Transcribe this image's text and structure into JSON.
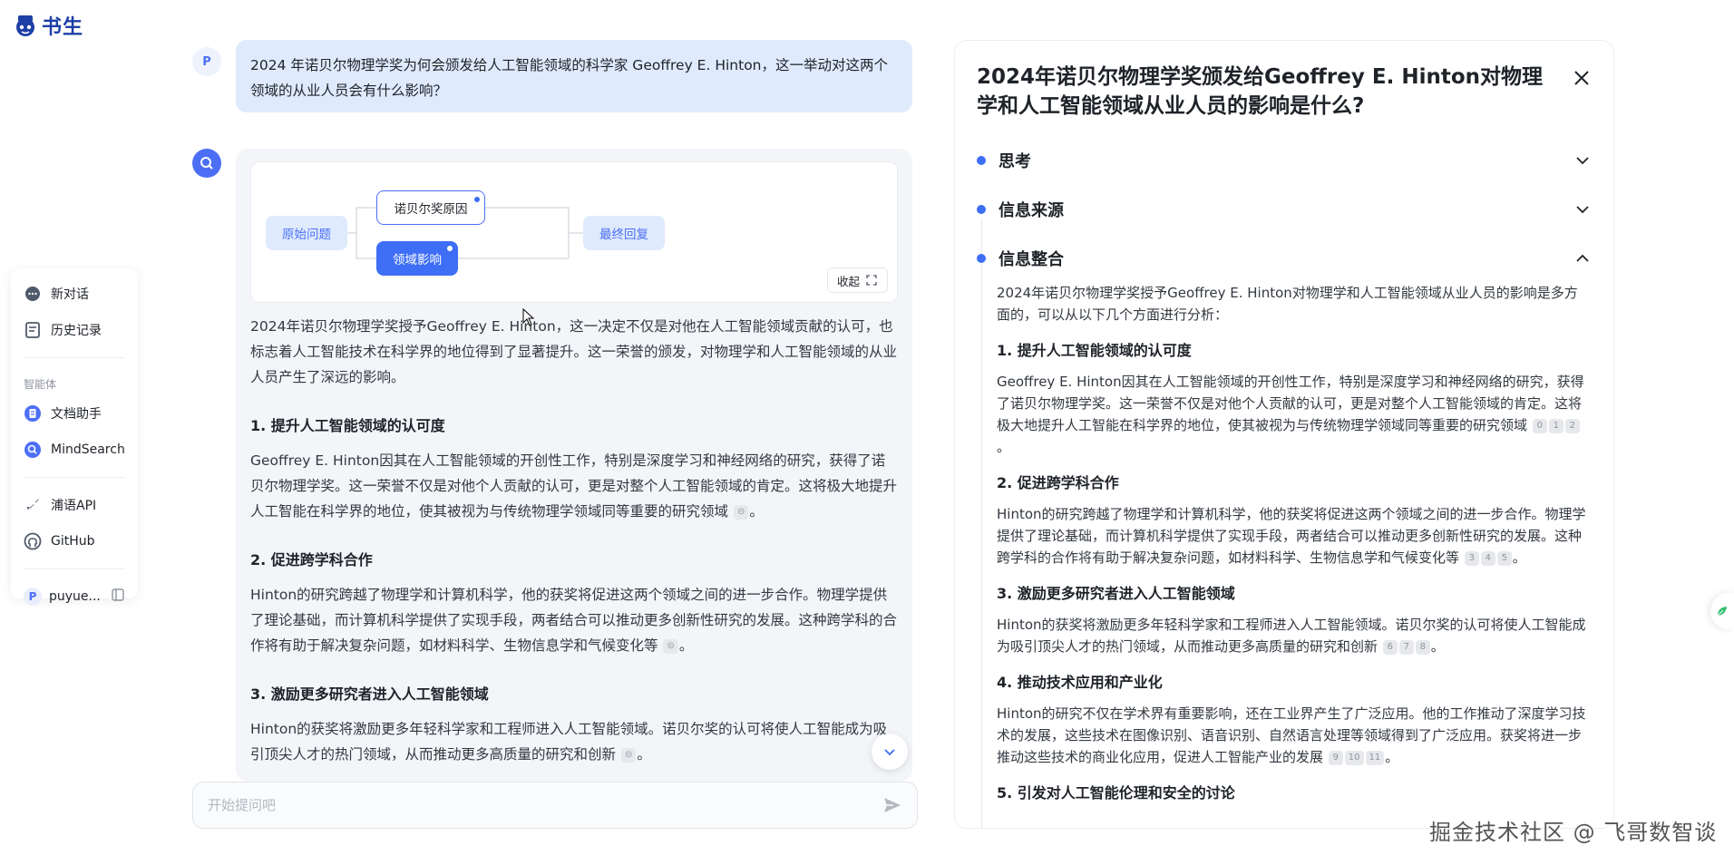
{
  "logo": {
    "text": "书生"
  },
  "sidebar": {
    "new_chat": "新对话",
    "history": "历史记录",
    "agents_section": "智能体",
    "doc_assistant": "文档助手",
    "mindsearch": "MindSearch",
    "api": "浦语API",
    "github": "GitHub",
    "user_initial": "P",
    "user_name": "puyue..."
  },
  "chat": {
    "user_initial": "P",
    "question": "2024 年诺贝尔物理学奖为何会颁发给人工智能领域的科学家 Geoffrey E. Hinton，这一举动对这两个领域的从业人员会有什么影响？",
    "mindmap": {
      "root": "原始问题",
      "node_reason": "诺贝尔奖原因",
      "node_impact": "领域影响",
      "final": "最终回复",
      "collapse": "收起"
    },
    "intro": "2024年诺贝尔物理学奖授予Geoffrey E. Hinton，这一决定不仅是对他在人工智能领域贡献的认可，也标志着人工智能技术在科学界的地位得到了显著提升。这一荣誉的颁发，对物理学和人工智能领域的从业人员产生了深远的影响。",
    "sections": [
      {
        "heading": "1. 提升人工智能领域的认可度",
        "text": "Geoffrey E. Hinton因其在人工智能领域的开创性工作，特别是深度学习和神经网络的研究，获得了诺贝尔物理学奖。这一荣誉不仅是对他个人贡献的认可，更是对整个人工智能领域的肯定。这将极大地提升人工智能在科学界的地位，使其被视为与传统物理学领域同等重要的研究领域"
      },
      {
        "heading": "2. 促进跨学科合作",
        "text": "Hinton的研究跨越了物理学和计算机科学，他的获奖将促进这两个领域之间的进一步合作。物理学提供了理论基础，而计算机科学提供了实现手段，两者结合可以推动更多创新性研究的发展。这种跨学科的合作将有助于解决复杂问题，如材料科学、生物信息学和气候变化等"
      },
      {
        "heading": "3. 激励更多研究者进入人工智能领域",
        "text": "Hinton的获奖将激励更多年轻科学家和工程师进入人工智能领域。诺贝尔奖的认可将使人工智能成为吸引顶尖人才的热门领域，从而推动更多高质量的研究和创新"
      }
    ],
    "input_placeholder": "开始提问吧"
  },
  "panel": {
    "title": "2024年诺贝尔物理学奖颁发给Geoffrey E. Hinton对物理学和人工智能领域从业人员的影响是什么?",
    "steps": [
      "思考",
      "信息来源",
      "信息整合"
    ],
    "intro": "2024年诺贝尔物理学奖授予Geoffrey E. Hinton对物理学和人工智能领域从业人员的影响是多方面的，可以从以下几个方面进行分析：",
    "sections": [
      {
        "heading": "1. 提升人工智能领域的认可度",
        "text": "Geoffrey E. Hinton因其在人工智能领域的开创性工作，特别是深度学习和神经网络的研究，获得了诺贝尔物理学奖。这一荣誉不仅是对他个人贡献的认可，更是对整个人工智能领域的肯定。这将极大地提升人工智能在科学界的地位，使其被视为与传统物理学领域同等重要的研究领域",
        "cites": [
          "0",
          "1",
          "2"
        ]
      },
      {
        "heading": "2. 促进跨学科合作",
        "text": "Hinton的研究跨越了物理学和计算机科学，他的获奖将促进这两个领域之间的进一步合作。物理学提供了理论基础，而计算机科学提供了实现手段，两者结合可以推动更多创新性研究的发展。这种跨学科的合作将有助于解决复杂问题，如材料科学、生物信息学和气候变化等",
        "cites": [
          "3",
          "4",
          "5"
        ]
      },
      {
        "heading": "3. 激励更多研究者进入人工智能领域",
        "text": "Hinton的获奖将激励更多年轻科学家和工程师进入人工智能领域。诺贝尔奖的认可将使人工智能成为吸引顶尖人才的热门领域，从而推动更多高质量的研究和创新",
        "cites": [
          "6",
          "7",
          "8"
        ]
      },
      {
        "heading": "4. 推动技术应用和产业化",
        "text": "Hinton的研究不仅在学术界有重要影响，还在工业界产生了广泛应用。他的工作推动了深度学习技术的发展，这些技术在图像识别、语音识别、自然语言处理等领域得到了广泛应用。获奖将进一步推动这些技术的商业化应用，促进人工智能产业的发展",
        "cites": [
          "9",
          "10",
          "11"
        ]
      },
      {
        "heading": "5. 引发对人工智能伦理和安全的讨论",
        "text": "",
        "cites": []
      }
    ]
  },
  "watermark": "掘金技术社区 @ 飞哥数智谈",
  "colors": {
    "accent": "#3d6ef5",
    "bubble": "#dfeafd",
    "card": "#f3f5f9"
  }
}
